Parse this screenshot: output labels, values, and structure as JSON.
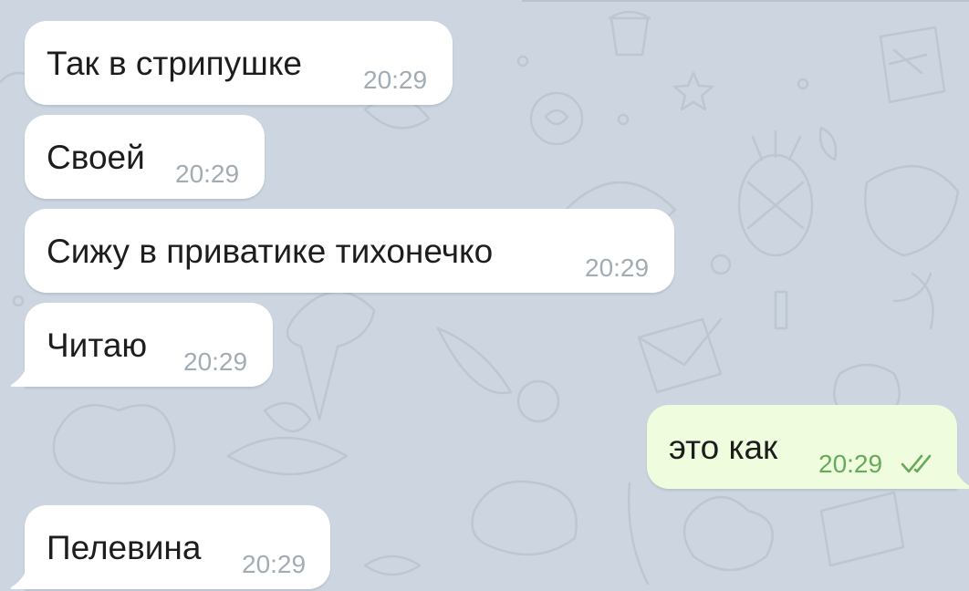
{
  "messages": [
    {
      "direction": "in",
      "text": "Так в стрипушке",
      "time": "20:29"
    },
    {
      "direction": "in",
      "text": "Своей",
      "time": "20:29"
    },
    {
      "direction": "in",
      "text": "Сижу в приватике тихонечко",
      "time": "20:29"
    },
    {
      "direction": "in",
      "text": "Читаю",
      "time": "20:29"
    },
    {
      "direction": "out",
      "text": "это как",
      "time": "20:29",
      "status": "read-double-check-icon"
    },
    {
      "direction": "in",
      "text": "Пелевина",
      "time": "20:29"
    }
  ],
  "colors": {
    "background": "#cdd6e0",
    "incoming_bubble": "#ffffff",
    "outgoing_bubble": "#effdde",
    "time_incoming": "#a2acb5",
    "time_outgoing": "#66aa5a"
  }
}
